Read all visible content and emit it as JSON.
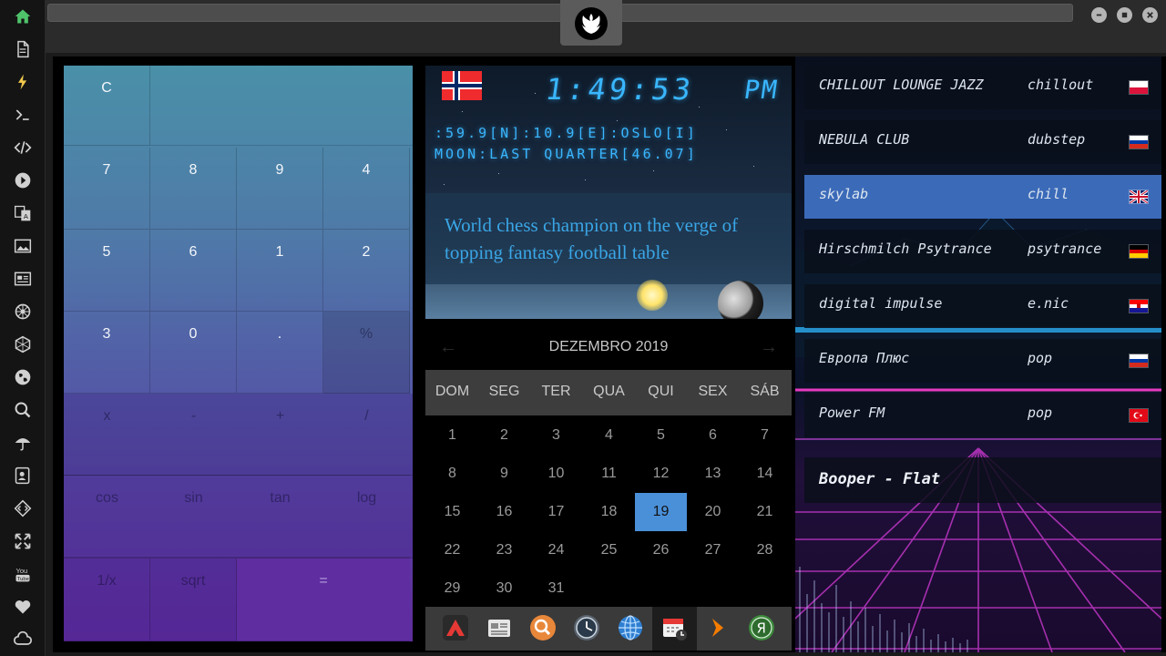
{
  "sidebar": {
    "items": [
      {
        "icon": "home-icon"
      },
      {
        "icon": "document-icon"
      },
      {
        "icon": "lightning-icon"
      },
      {
        "icon": "terminal-icon"
      },
      {
        "icon": "code-icon"
      },
      {
        "icon": "play-icon"
      },
      {
        "icon": "translate-icon"
      },
      {
        "icon": "image-icon"
      },
      {
        "icon": "news-icon"
      },
      {
        "icon": "settings-wheel-icon"
      },
      {
        "icon": "hexagon-icon"
      },
      {
        "icon": "globe-icon"
      },
      {
        "icon": "search-icon"
      },
      {
        "icon": "umbrella-icon"
      },
      {
        "icon": "contacts-icon"
      },
      {
        "icon": "diamond-code-icon"
      },
      {
        "icon": "expand-icon"
      },
      {
        "icon": "youtube-icon"
      },
      {
        "icon": "heart-icon"
      },
      {
        "icon": "cloud-icon"
      }
    ]
  },
  "calculator": {
    "clear": "C",
    "digits": [
      [
        "7",
        "8",
        "9",
        "4"
      ],
      [
        "5",
        "6",
        "1",
        "2"
      ],
      [
        "3",
        "0",
        ".",
        "%"
      ]
    ],
    "operators": [
      "x",
      "-",
      "+",
      "/"
    ],
    "functions": [
      "cos",
      "sin",
      "tan",
      "log"
    ],
    "bottom": [
      "1/x",
      "sqrt",
      "="
    ]
  },
  "clock": {
    "time": "1:49:53",
    "ampm": "PM",
    "coords": ":59.9[N]:10.9[E]:OSLO[I]",
    "moon": "MOON:LAST QUARTER[46.07]",
    "news": "World chess champion on the verge of topping fantasy football table"
  },
  "calendar": {
    "month": "DEZEMBRO 2019",
    "days": [
      "DOM",
      "SEG",
      "TER",
      "QUA",
      "QUI",
      "SEX",
      "SÁB"
    ],
    "weeks": [
      [
        "1",
        "2",
        "3",
        "4",
        "5",
        "6",
        "7"
      ],
      [
        "8",
        "9",
        "10",
        "11",
        "12",
        "13",
        "14"
      ],
      [
        "15",
        "16",
        "17",
        "18",
        "19",
        "20",
        "21"
      ],
      [
        "22",
        "23",
        "24",
        "25",
        "26",
        "27",
        "28"
      ],
      [
        "29",
        "30",
        "31",
        "",
        "",
        "",
        ""
      ]
    ],
    "today": "19"
  },
  "dock": {
    "apps": [
      "red-triangle-app-icon",
      "news-app-icon",
      "search-app-icon",
      "clock-app-icon",
      "globe-app-icon",
      "calendar-app-icon",
      "arrow-app-icon",
      "yandex-app-icon"
    ]
  },
  "radio": {
    "stations": [
      {
        "name": "CHILLOUT LOUNGE JAZZ",
        "genre": "chillout",
        "flag": "poland"
      },
      {
        "name": "NEBULA CLUB",
        "genre": "dubstep",
        "flag": "russia"
      },
      {
        "name": "skylab",
        "genre": "chill",
        "flag": "uk",
        "active": true
      },
      {
        "name": "Hirschmilch Psytrance",
        "genre": "psytrance",
        "flag": "germany"
      },
      {
        "name": "digital impulse",
        "genre": "e.nic",
        "flag": "croatia"
      },
      {
        "name": "Европа Плюс",
        "genre": "pop",
        "flag": "russia"
      },
      {
        "name": "Power FM",
        "genre": "pop",
        "flag": "turkey"
      }
    ],
    "now_playing": "Booper - Flat"
  },
  "colors": {
    "accent": "#4a90d9",
    "digital": "#39b6ff",
    "active_station": "#3b6ab8"
  }
}
